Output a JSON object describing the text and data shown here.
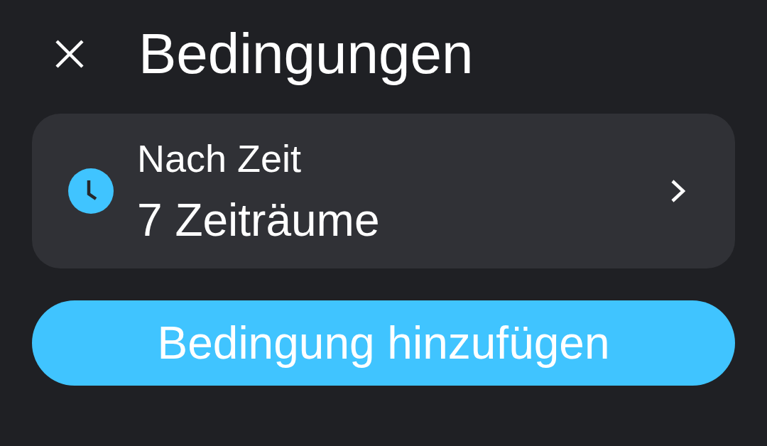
{
  "header": {
    "title": "Bedingungen"
  },
  "conditions": [
    {
      "kind": "time",
      "title": "Nach Zeit",
      "summary": "7 Zeiträume"
    }
  ],
  "add_button": {
    "label": "Bedingung hinzufügen"
  }
}
